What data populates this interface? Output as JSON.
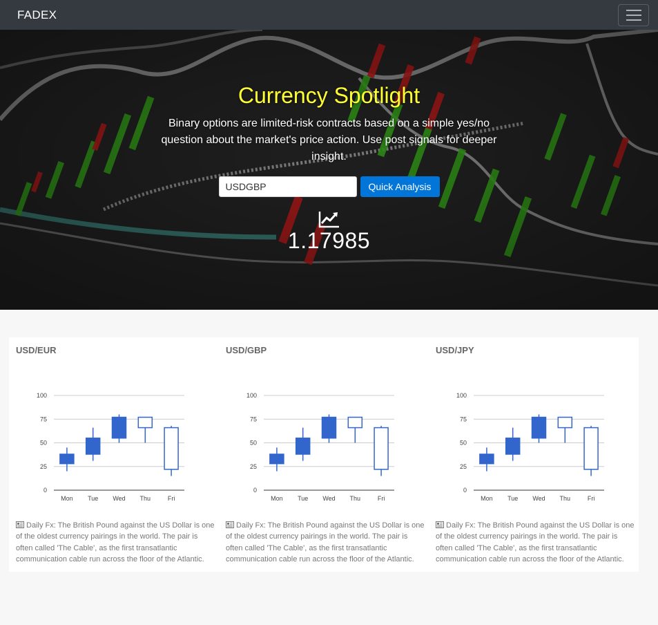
{
  "navbar": {
    "brand": "FADEX"
  },
  "hero": {
    "title": "Currency Spotlight",
    "subtitle": "Binary options are limited-risk contracts based on a simple yes/no question about the market's price action. Use post signals for deeper insight.",
    "search_value": "USDGBP",
    "button_label": "Quick Analysis",
    "rate": "1.17985"
  },
  "colors": {
    "title": "#ffff33",
    "button": "#0275d8",
    "candle": "#3366cc"
  },
  "cards": [
    {
      "title": "USD/EUR",
      "desc": "Daily Fx: The British Pound against the US Dollar is one of the oldest currency pairings in the world. The pair is often called 'The Cable', as the first transatlantic communication cable run across the floor of the Atlantic."
    },
    {
      "title": "USD/GBP",
      "desc": "Daily Fx: The British Pound against the US Dollar is one of the oldest currency pairings in the world. The pair is often called 'The Cable', as the first transatlantic communication cable run across the floor of the Atlantic."
    },
    {
      "title": "USD/JPY",
      "desc": "Daily Fx: The British Pound against the US Dollar is one of the oldest currency pairings in the world. The pair is often called 'The Cable', as the first transatlantic communication cable run across the floor of the Atlantic."
    }
  ],
  "chart_data": [
    {
      "type": "candlestick",
      "categories": [
        "Mon",
        "Tue",
        "Wed",
        "Thu",
        "Fri"
      ],
      "ylim": [
        0,
        100
      ],
      "yticks": [
        "0",
        "25",
        "50",
        "75",
        "100"
      ],
      "candles": [
        {
          "low": 20,
          "open": 28,
          "close": 38,
          "high": 45
        },
        {
          "low": 31,
          "open": 38,
          "close": 55,
          "high": 66
        },
        {
          "low": 50,
          "open": 55,
          "close": 77,
          "high": 80
        },
        {
          "low": 50,
          "open": 77,
          "close": 66,
          "high": 77
        },
        {
          "low": 15,
          "open": 66,
          "close": 22,
          "high": 68
        }
      ]
    },
    {
      "type": "candlestick",
      "categories": [
        "Mon",
        "Tue",
        "Wed",
        "Thu",
        "Fri"
      ],
      "ylim": [
        0,
        100
      ],
      "yticks": [
        "0",
        "25",
        "50",
        "75",
        "100"
      ],
      "candles": [
        {
          "low": 20,
          "open": 28,
          "close": 38,
          "high": 45
        },
        {
          "low": 31,
          "open": 38,
          "close": 55,
          "high": 66
        },
        {
          "low": 50,
          "open": 55,
          "close": 77,
          "high": 80
        },
        {
          "low": 50,
          "open": 77,
          "close": 66,
          "high": 77
        },
        {
          "low": 15,
          "open": 66,
          "close": 22,
          "high": 68
        }
      ]
    },
    {
      "type": "candlestick",
      "categories": [
        "Mon",
        "Tue",
        "Wed",
        "Thu",
        "Fri"
      ],
      "ylim": [
        0,
        100
      ],
      "yticks": [
        "0",
        "25",
        "50",
        "75",
        "100"
      ],
      "candles": [
        {
          "low": 20,
          "open": 28,
          "close": 38,
          "high": 45
        },
        {
          "low": 31,
          "open": 38,
          "close": 55,
          "high": 66
        },
        {
          "low": 50,
          "open": 55,
          "close": 77,
          "high": 80
        },
        {
          "low": 50,
          "open": 77,
          "close": 66,
          "high": 77
        },
        {
          "low": 15,
          "open": 66,
          "close": 22,
          "high": 68
        }
      ]
    }
  ]
}
